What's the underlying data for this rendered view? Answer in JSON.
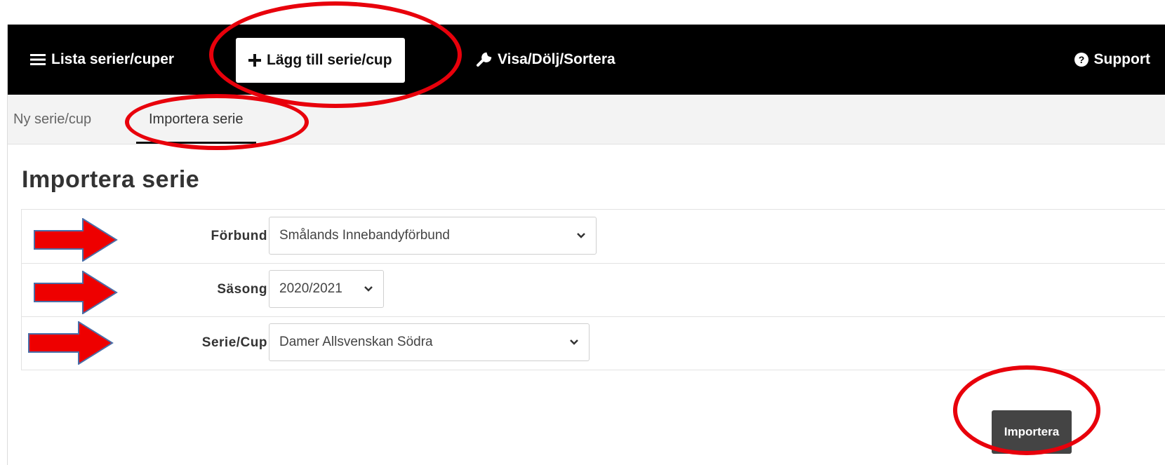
{
  "navbar": {
    "list_label": "Lista serier/cuper",
    "add_label": "Lägg till serie/cup",
    "sort_label": "Visa/Dölj/Sortera",
    "support_label": "Support"
  },
  "subnav": {
    "tabs": [
      {
        "label": "Ny serie/cup"
      },
      {
        "label": "Importera serie"
      }
    ]
  },
  "page": {
    "title": "Importera serie"
  },
  "form": {
    "fields": [
      {
        "label": "Förbund",
        "value": "Smålands Innebandyförbund"
      },
      {
        "label": "Säsong",
        "value": "2020/2021"
      },
      {
        "label": "Serie/Cup",
        "value": "Damer Allsvenskan Södra"
      }
    ],
    "submit_label": "Importera"
  },
  "colors": {
    "navbar_bg": "#000000",
    "annotation_red": "#e8000b",
    "button_bg": "#444444"
  },
  "icons": {
    "list": "hamburger-icon",
    "add": "plus-icon",
    "sort": "wrench-icon",
    "support": "question-circle-icon",
    "select": "chevron-down-icon"
  }
}
